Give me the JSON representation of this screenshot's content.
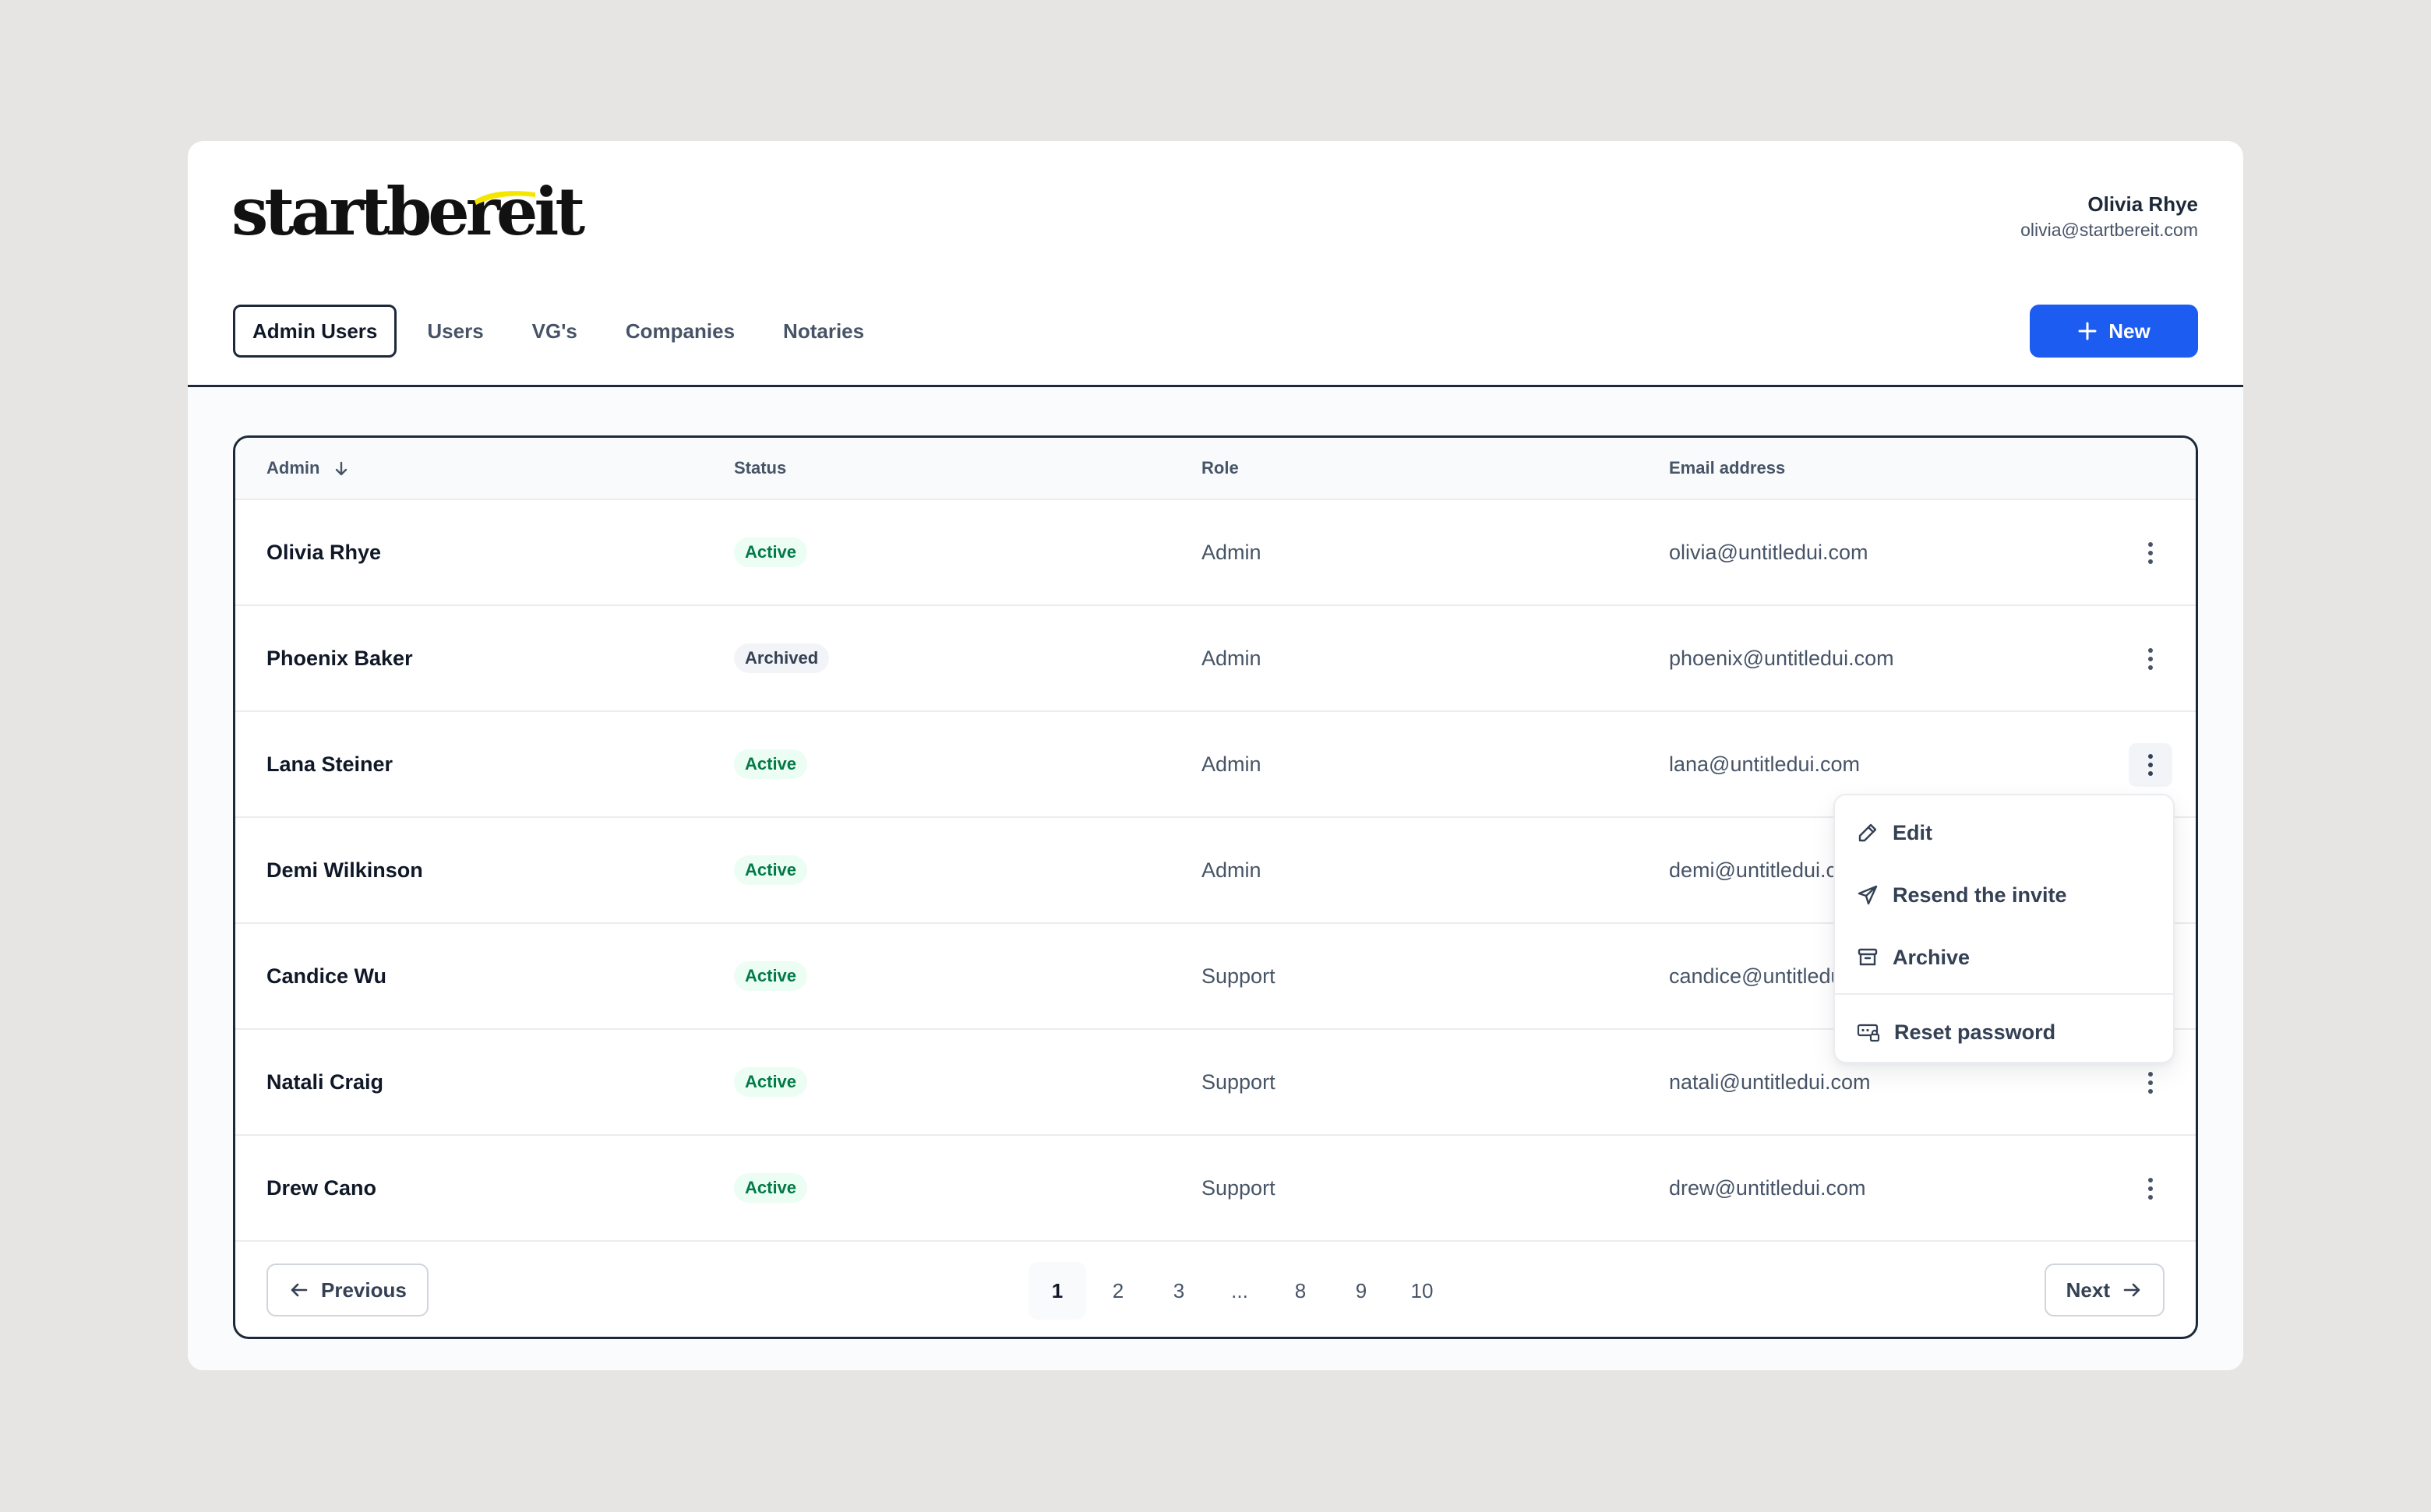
{
  "brand": {
    "logo_text": "startbereit",
    "accent_color": "#f5e600"
  },
  "profile": {
    "name": "Olivia Rhye",
    "email": "olivia@startbereit.com"
  },
  "tabs": [
    {
      "label": "Admin Users",
      "active": true
    },
    {
      "label": "Users",
      "active": false
    },
    {
      "label": "VG's",
      "active": false
    },
    {
      "label": "Companies",
      "active": false
    },
    {
      "label": "Notaries",
      "active": false
    }
  ],
  "new_button": {
    "label": "New",
    "icon": "plus-icon",
    "color": "#1c5cf0"
  },
  "table": {
    "headers": {
      "admin": "Admin",
      "status": "Status",
      "role": "Role",
      "email": "Email address"
    },
    "sort_icon": "arrow-down-icon",
    "rows": [
      {
        "name": "Olivia Rhye",
        "status": "Active",
        "role": "Admin",
        "email": "olivia@untitledui.com"
      },
      {
        "name": "Phoenix Baker",
        "status": "Archived",
        "role": "Admin",
        "email": "phoenix@untitledui.com"
      },
      {
        "name": "Lana Steiner",
        "status": "Active",
        "role": "Admin",
        "email": "lana@untitledui.com"
      },
      {
        "name": "Demi Wilkinson",
        "status": "Active",
        "role": "Admin",
        "email": "demi@untitledui.c"
      },
      {
        "name": "Candice Wu",
        "status": "Active",
        "role": "Support",
        "email": "candice@untitledu"
      },
      {
        "name": "Natali Craig",
        "status": "Active",
        "role": "Support",
        "email": "natali@untitledui.com"
      },
      {
        "name": "Drew Cano",
        "status": "Active",
        "role": "Support",
        "email": "drew@untitledui.com"
      }
    ]
  },
  "pagination": {
    "previous_label": "Previous",
    "next_label": "Next",
    "pages": [
      "1",
      "2",
      "3",
      "...",
      "8",
      "9",
      "10"
    ],
    "current": "1"
  },
  "row_menu": {
    "open_row": "Lana Steiner",
    "items": [
      {
        "label": "Edit",
        "icon": "pencil-icon"
      },
      {
        "label": "Resend the invite",
        "icon": "send-icon"
      },
      {
        "label": "Archive",
        "icon": "archive-icon"
      },
      {
        "label": "Reset password",
        "icon": "password-icon"
      }
    ]
  }
}
